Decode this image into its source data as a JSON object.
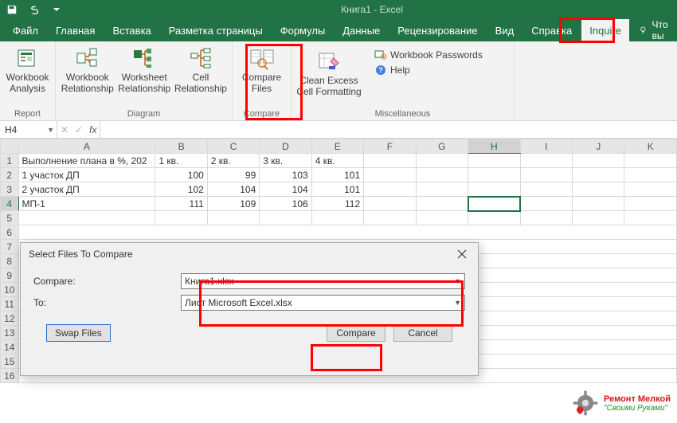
{
  "window": {
    "title": "Книга1 - Excel"
  },
  "menus": {
    "items": [
      "Файл",
      "Главная",
      "Вставка",
      "Разметка страницы",
      "Формулы",
      "Данные",
      "Рецензирование",
      "Вид",
      "Справка",
      "Inquire"
    ],
    "right_trail": "Что вы"
  },
  "ribbon": {
    "report": {
      "label": "Report",
      "workbook_analysis": "Workbook\nAnalysis"
    },
    "diagram": {
      "label": "Diagram",
      "workbook_rel": "Workbook\nRelationship",
      "worksheet_rel": "Worksheet\nRelationship",
      "cell_rel": "Cell\nRelationship"
    },
    "compare": {
      "label": "Compare",
      "compare_files": "Compare\nFiles"
    },
    "misc": {
      "label": "Miscellaneous",
      "clean": "Clean Excess\nCell Formatting",
      "passwords": "Workbook Passwords",
      "help": "Help"
    }
  },
  "namebox": "H4",
  "columns": [
    "A",
    "B",
    "C",
    "D",
    "E",
    "F",
    "G",
    "H",
    "I",
    "J",
    "K"
  ],
  "row_headers": [
    "1",
    "2",
    "3",
    "4",
    "5",
    "6",
    "7",
    "8",
    "9",
    "10",
    "11",
    "12",
    "13",
    "14",
    "15",
    "16"
  ],
  "cells": {
    "r1": [
      "Выполнение плана в %, 202",
      "1 кв.",
      "2 кв.",
      "3 кв.",
      "4 кв."
    ],
    "r2": [
      "1 участок ДП",
      "100",
      "99",
      "103",
      "101"
    ],
    "r3": [
      "2 участок ДП",
      "102",
      "104",
      "104",
      "101"
    ],
    "r4": [
      "МП-1",
      "111",
      "109",
      "106",
      "112"
    ]
  },
  "dialog": {
    "title": "Select Files To Compare",
    "compare_label": "Compare:",
    "to_label": "To:",
    "file1": "Книга1.xlsx",
    "file2": "Лист Microsoft Excel.xlsx",
    "swap": "Swap Files",
    "compare_btn": "Compare",
    "cancel_btn": "Cancel"
  },
  "watermark": {
    "line1": "Ремонт Мелкой",
    "line2": "\"Своими Руками\""
  }
}
